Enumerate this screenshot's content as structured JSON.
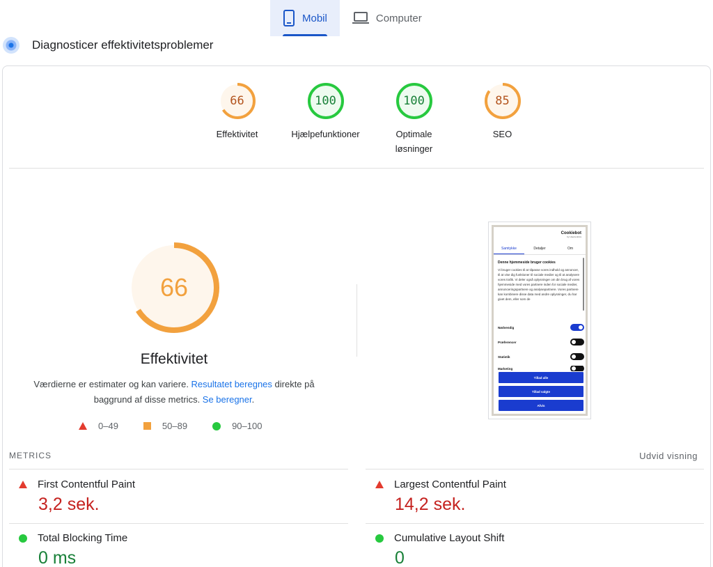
{
  "tabs": [
    {
      "label": "Mobil",
      "icon": "phone-icon",
      "active": true
    },
    {
      "label": "Computer",
      "icon": "laptop-icon",
      "active": false
    }
  ],
  "diagnose_title": "Diagnosticer effektivitetsproblemer",
  "gauges": [
    {
      "score": "66",
      "label": "Effektivitet",
      "status": "average"
    },
    {
      "score": "100",
      "label": "Hjælpefunktioner",
      "status": "pass"
    },
    {
      "score": "100",
      "label": "Optimale løsninger",
      "status": "pass"
    },
    {
      "score": "85",
      "label": "SEO",
      "status": "average"
    }
  ],
  "main_score": {
    "score": "66",
    "fraction": 0.66,
    "label": "Effektivitet"
  },
  "note": {
    "text1": "Værdierne er estimater og kan variere. ",
    "link1": "Resultatet beregnes",
    "text2": " direkte på baggrund af disse metrics. ",
    "link2": "Se beregner",
    "text3": "."
  },
  "legend": [
    {
      "range": "0–49",
      "shape": "triangle"
    },
    {
      "range": "50–89",
      "shape": "square"
    },
    {
      "range": "90–100",
      "shape": "circle"
    }
  ],
  "preview": {
    "logo": "Cookiebot",
    "logo_sub": "by Usercentrics",
    "tabs": [
      "Samtykke",
      "Detaljer",
      "Om"
    ],
    "heading": "Denne hjemmeside bruger cookies",
    "body": "Vi bruger cookies til at tilpasse vores indhold og annoncer, til at vise dig funktioner til sociale medier og til at analysere vores trafik. Vi deler også oplysninger om din brug af vores hjemmeside med vores partnere inden for sociale medier, annonceringspartnere og analysepartnere. Vores partnere kan kombinere disse data med andre oplysninger, du har givet dem, eller som de",
    "toggles": [
      {
        "label": "Nødvendig",
        "on": true
      },
      {
        "label": "Præferencer",
        "on": false
      },
      {
        "label": "Statistik",
        "on": false
      },
      {
        "label": "Marketing",
        "on": false
      }
    ],
    "buttons": [
      "Tillad alle",
      "Tillad valgte",
      "Afvis"
    ]
  },
  "metrics_heading": "METRICS",
  "expand_label": "Udvid visning",
  "metrics": [
    {
      "name": "First Contentful Paint",
      "value": "3,2 sek.",
      "status": "fail"
    },
    {
      "name": "Largest Contentful Paint",
      "value": "14,2 sek.",
      "status": "fail"
    },
    {
      "name": "Total Blocking Time",
      "value": "0 ms",
      "status": "pass"
    },
    {
      "name": "Cumulative Layout Shift",
      "value": "0",
      "status": "pass"
    }
  ],
  "colors": {
    "fail": "#c5221f",
    "average": "#f2a13e",
    "pass": "#27c93f",
    "accent": "#1a56c8"
  }
}
